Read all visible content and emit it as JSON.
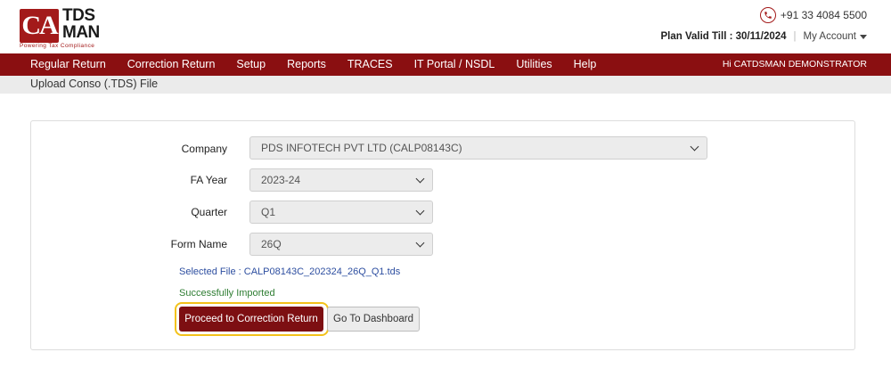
{
  "brand": {
    "logo_mark": "CA",
    "logo_word1": "TDS",
    "logo_word2": "MAN",
    "tagline": "Powering Tax Compliance",
    "accent_color": "#8a0f11"
  },
  "header": {
    "phone": "+91 33 4084 5500",
    "phone_icon": "phone-icon",
    "plan_label": "Plan Valid Till : 30/11/2024",
    "separator": "|",
    "account_label": "My Account"
  },
  "nav": {
    "items": [
      "Regular Return",
      "Correction Return",
      "Setup",
      "Reports",
      "TRACES",
      "IT Portal / NSDL",
      "Utilities",
      "Help"
    ],
    "user_greeting": "Hi CATDSMAN DEMONSTRATOR"
  },
  "page": {
    "title": "Upload Conso (.TDS) File"
  },
  "form": {
    "company_label": "Company",
    "company_value": "PDS INFOTECH PVT LTD (CALP08143C)",
    "fa_year_label": "FA Year",
    "fa_year_value": "2023-24",
    "quarter_label": "Quarter",
    "quarter_value": "Q1",
    "form_name_label": "Form Name",
    "form_name_value": "26Q",
    "selected_file": "Selected File : CALP08143C_202324_26Q_Q1.tds",
    "status": "Successfully Imported",
    "proceed_button": "Proceed to Correction Return",
    "dashboard_button": "Go To Dashboard"
  }
}
